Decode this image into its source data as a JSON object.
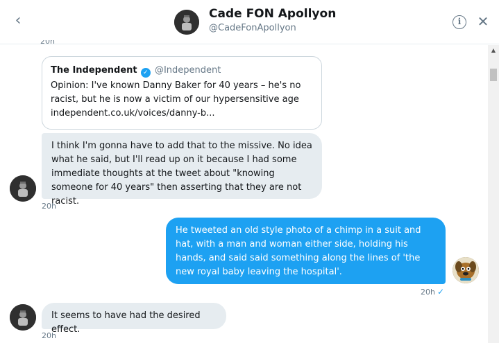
{
  "header": {
    "title": "Cade FON Apollyon",
    "handle": "@CadeFonApollyon",
    "back_icon": "‹",
    "info_icon": "i",
    "close_icon": "✕"
  },
  "partial_timestamp": "20h",
  "quote": {
    "name": "The Independent",
    "handle": "@Independent",
    "verified_icon": "✓",
    "line1": "Opinion: I've known Danny Baker for 40 years – he's no",
    "line2": "racist, but he is now a victim of our hypersensitive age",
    "link": "independent.co.uk/voices/danny-b..."
  },
  "messages": [
    {
      "text": "I think I'm gonna have to add that to the missive. No idea what he said, but I'll read up on it because I had some immediate thoughts at the tweet about \"knowing someone for 40 years\" then asserting that they are not racist.",
      "timestamp": "20h"
    },
    {
      "text": "He tweeted an old style photo of a chimp in a suit and hat, with a man and woman either side, holding his hands, and said said something along the lines of 'the new royal baby leaving the hospital'.",
      "timestamp": "20h",
      "status_icon": "✓"
    },
    {
      "text": "It seems to have had the desired effect.",
      "timestamp": "20h"
    }
  ],
  "colors": {
    "accent": "#1da1f2",
    "incoming_bubble": "#e6ecf0",
    "muted_text": "#657786"
  }
}
